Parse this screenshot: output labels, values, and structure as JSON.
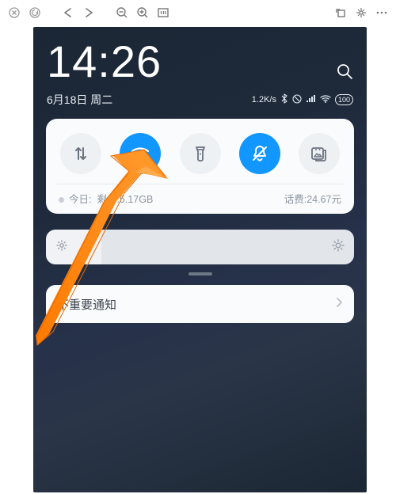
{
  "status": {
    "time": "14:26",
    "date": "6月18日 周二",
    "net_speed": "1.2K/s",
    "battery": "100"
  },
  "quick_settings": {
    "items": [
      {
        "name": "mobile-data",
        "on": false
      },
      {
        "name": "wifi",
        "on": true
      },
      {
        "name": "flashlight",
        "on": false
      },
      {
        "name": "dnd",
        "on": true
      },
      {
        "name": "screenshot",
        "on": false
      }
    ],
    "data_today_prefix": "今日:",
    "data_remaining": "剩余:5.17GB",
    "call_fee": "话费:24.67元"
  },
  "notifications": {
    "low_priority_label": "不重要通知"
  },
  "toolbar": {
    "close": "close",
    "reload": "reload",
    "back": "back",
    "forward": "forward",
    "zoom_out": "zoom-out",
    "zoom_in": "zoom-in",
    "fit": "one-to-one",
    "rotate": "rotate",
    "magic": "sparkle",
    "more": "more"
  }
}
